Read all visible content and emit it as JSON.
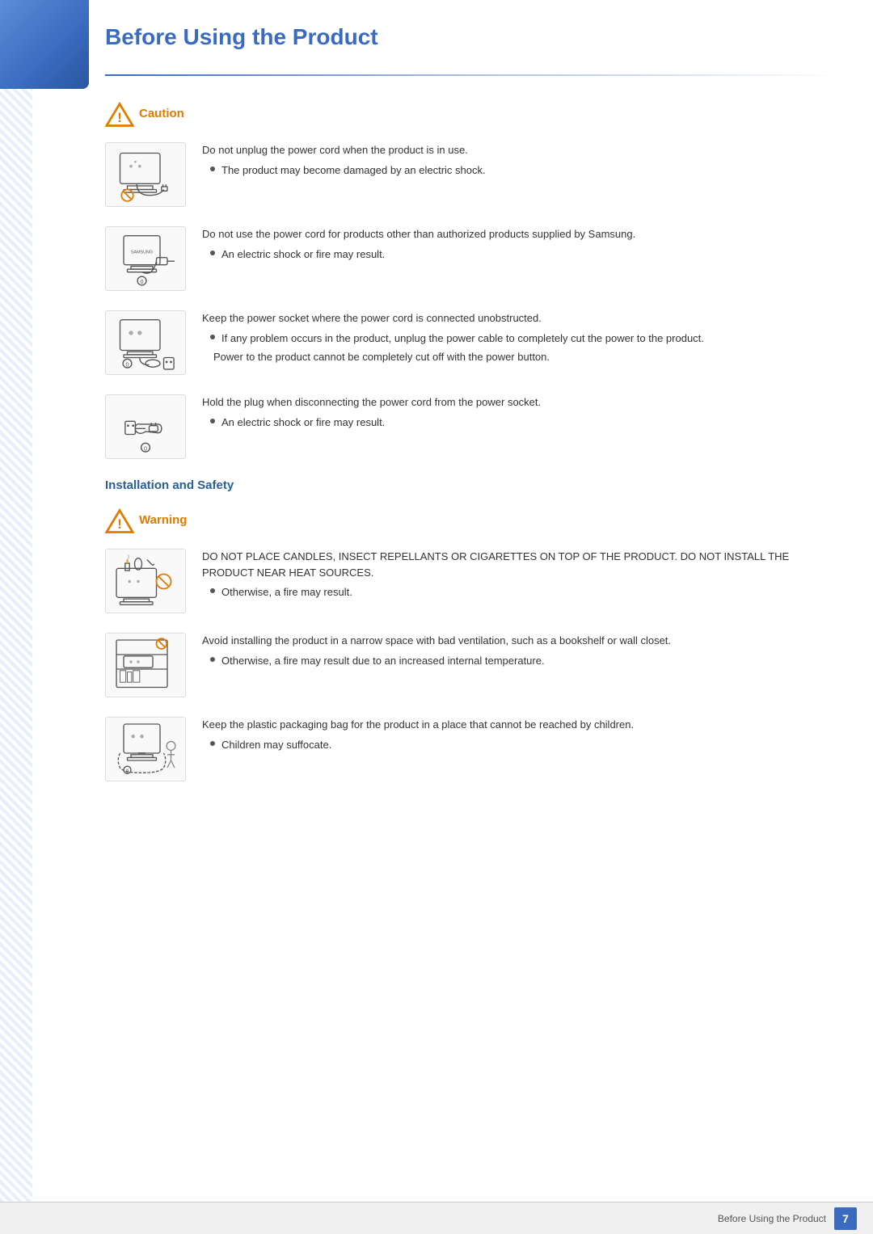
{
  "page": {
    "title": "Before Using the Product",
    "footer_text": "Before Using the Product",
    "footer_page": "7"
  },
  "caution_section": {
    "badge": "Caution",
    "items": [
      {
        "id": "caution-1",
        "main_text": "Do not unplug the power cord when the product is in use.",
        "bullets": [
          "The product may become damaged by an electric shock."
        ],
        "sub_texts": []
      },
      {
        "id": "caution-2",
        "main_text": "Do not use the power cord for products other than authorized products supplied by Samsung.",
        "bullets": [
          "An electric shock or fire may result."
        ],
        "sub_texts": []
      },
      {
        "id": "caution-3",
        "main_text": "Keep the power socket where the power cord is connected unobstructed.",
        "bullets": [
          "If any problem occurs in the product, unplug the power cable to completely cut the power to the product."
        ],
        "sub_texts": [
          "Power to the product cannot be completely cut off with the power button."
        ]
      },
      {
        "id": "caution-4",
        "main_text": "Hold the plug when disconnecting the power cord from the power socket.",
        "bullets": [
          "An electric shock or fire may result."
        ],
        "sub_texts": []
      }
    ]
  },
  "installation_section": {
    "heading": "Installation and Safety",
    "badge": "Warning",
    "items": [
      {
        "id": "warning-1",
        "main_text": "DO NOT PLACE CANDLES, INSECT REPELLANTS OR CIGARETTES ON TOP OF THE PRODUCT. DO NOT INSTALL THE PRODUCT NEAR HEAT SOURCES.",
        "bullets": [
          "Otherwise, a fire may result."
        ],
        "sub_texts": []
      },
      {
        "id": "warning-2",
        "main_text": "Avoid installing the product in a narrow space with bad ventilation, such as a bookshelf or wall closet.",
        "bullets": [
          "Otherwise, a fire may result due to an increased internal temperature."
        ],
        "sub_texts": []
      },
      {
        "id": "warning-3",
        "main_text": "Keep the plastic packaging bag for the product in a place that cannot be reached by children.",
        "bullets": [
          "Children may suffocate."
        ],
        "sub_texts": []
      }
    ]
  },
  "icons": {
    "triangle_warning": "⚠",
    "bullet": "•"
  }
}
